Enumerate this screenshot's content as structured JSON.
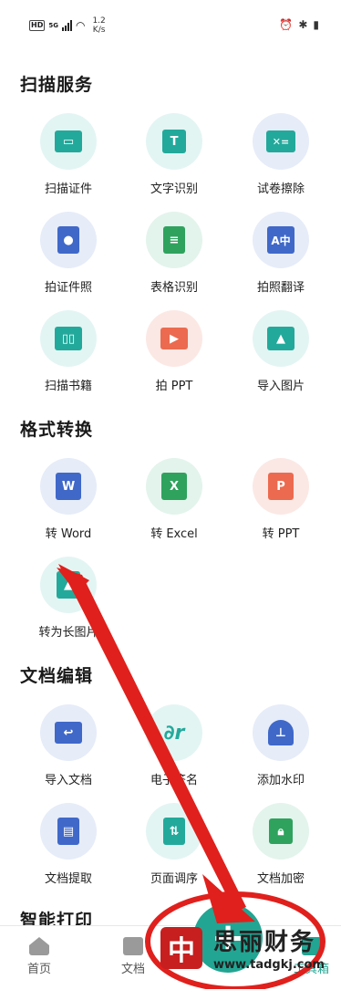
{
  "status_bar": {
    "hd": "HD",
    "signal_label": "5G",
    "speed_value": "1.2",
    "speed_unit": "K/s",
    "icons": [
      "alarm-icon",
      "bluetooth-icon",
      "battery-icon"
    ]
  },
  "sections": [
    {
      "title": "扫描服务",
      "items": [
        {
          "label": "扫描证件",
          "icon": "id-card-icon"
        },
        {
          "label": "文字识别",
          "icon": "text-recognition-icon"
        },
        {
          "label": "试卷擦除",
          "icon": "exam-erase-icon"
        },
        {
          "label": "拍证件照",
          "icon": "id-photo-icon"
        },
        {
          "label": "表格识别",
          "icon": "table-recognition-icon"
        },
        {
          "label": "拍照翻译",
          "icon": "translate-icon"
        },
        {
          "label": "扫描书籍",
          "icon": "book-scan-icon"
        },
        {
          "label": "拍 PPT",
          "icon": "ppt-capture-icon"
        },
        {
          "label": "导入图片",
          "icon": "image-import-icon"
        }
      ]
    },
    {
      "title": "格式转换",
      "items": [
        {
          "label": "转 Word",
          "icon": "word-icon",
          "glyph": "W"
        },
        {
          "label": "转 Excel",
          "icon": "excel-icon",
          "glyph": "X"
        },
        {
          "label": "转 PPT",
          "icon": "ppt-icon",
          "glyph": "P"
        },
        {
          "label": "转为长图片",
          "icon": "long-image-icon"
        }
      ]
    },
    {
      "title": "文档编辑",
      "items": [
        {
          "label": "导入文档",
          "icon": "folder-import-icon"
        },
        {
          "label": "电子签名",
          "icon": "signature-icon"
        },
        {
          "label": "添加水印",
          "icon": "stamp-icon"
        },
        {
          "label": "文档提取",
          "icon": "extract-icon"
        },
        {
          "label": "页面调序",
          "icon": "reorder-icon"
        },
        {
          "label": "文档加密",
          "icon": "lock-icon"
        }
      ]
    },
    {
      "title": "智能打印",
      "items": []
    }
  ],
  "bottom_nav": {
    "home": "首页",
    "docs": "文档",
    "toolbox": "工具箱"
  },
  "watermark": {
    "logo_char": "中",
    "title": "思丽财务",
    "url": "www.tadgkj.com"
  },
  "colors": {
    "teal": "#23a99b",
    "blue": "#3f68c9",
    "green": "#2fa25e",
    "orange": "#ec6a4f",
    "annotation_red": "#e0201c"
  }
}
